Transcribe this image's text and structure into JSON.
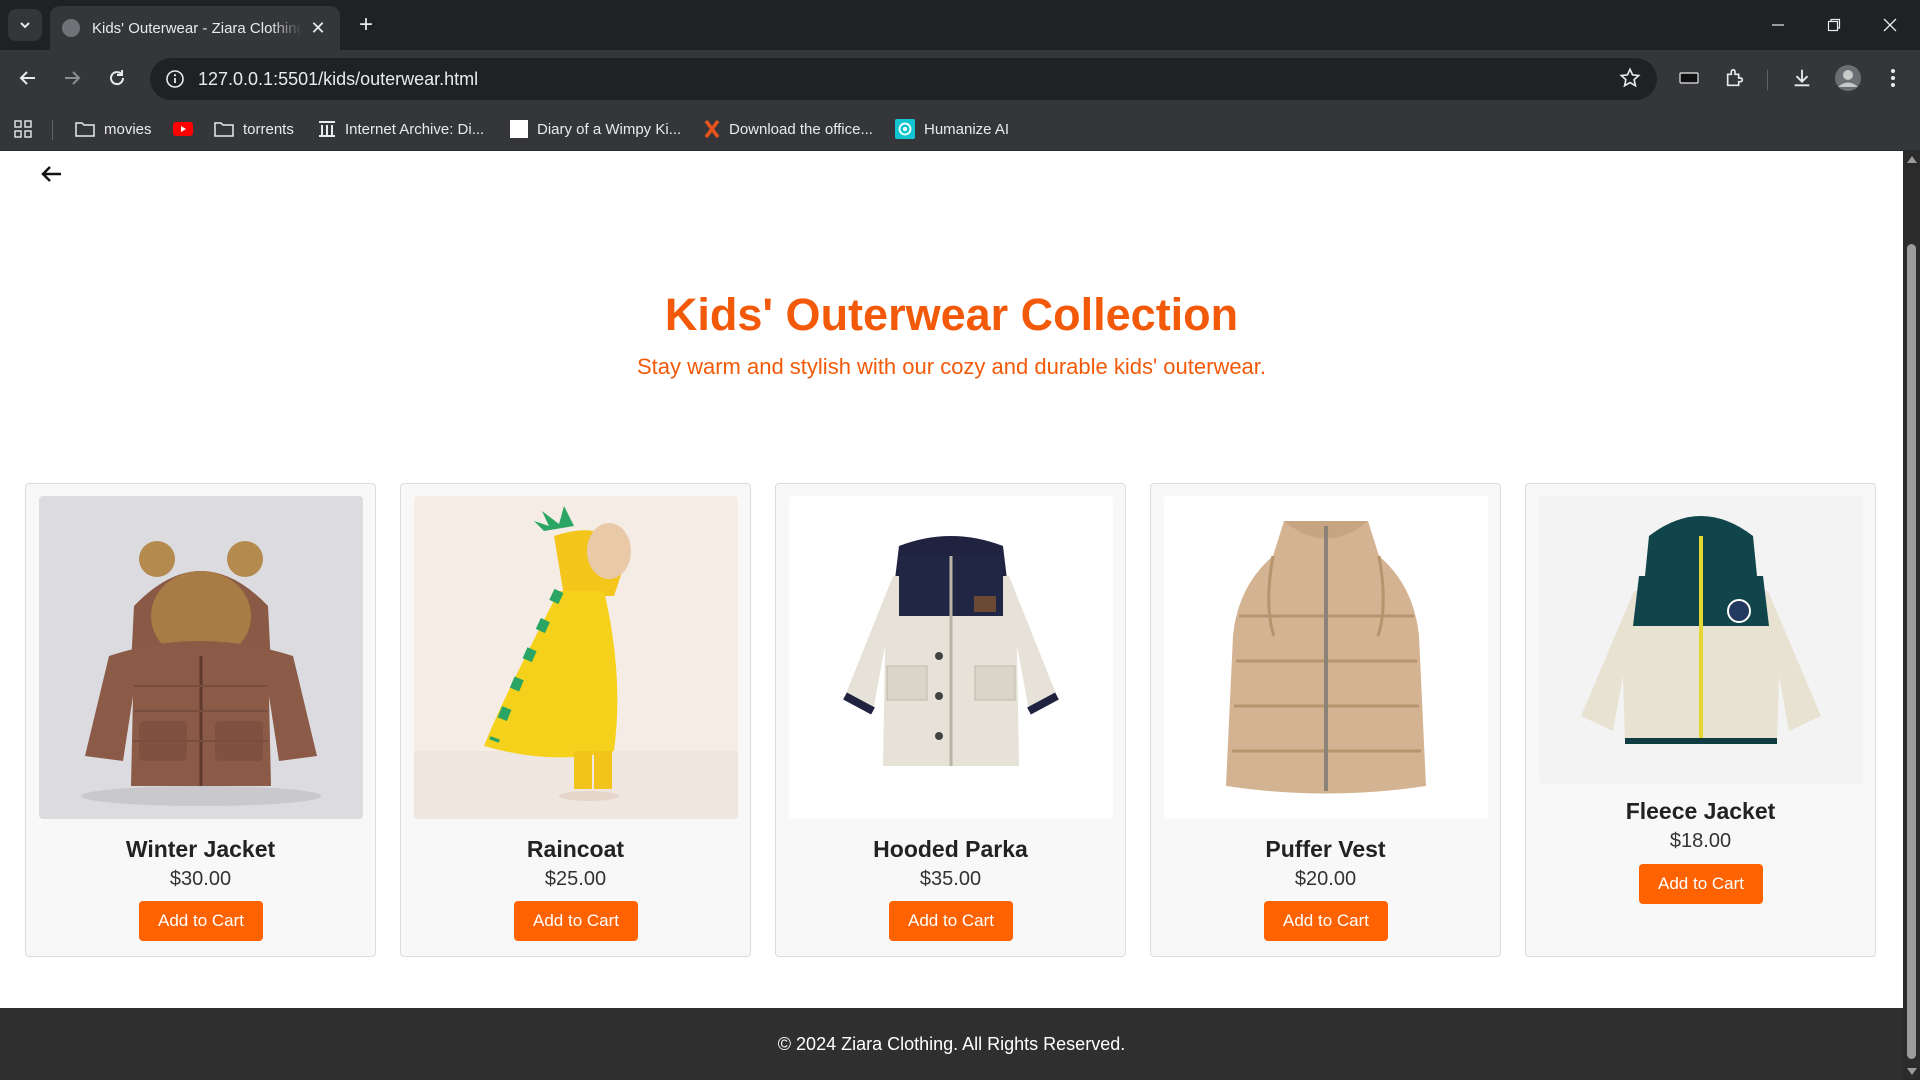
{
  "browser": {
    "tab_title": "Kids' Outerwear - Ziara Clothing",
    "url": "127.0.0.1:5501/kids/outerwear.html",
    "bookmarks": [
      {
        "label": "movies",
        "icon": "folder-icon"
      },
      {
        "label": "",
        "icon": "youtube-icon"
      },
      {
        "label": "torrents",
        "icon": "folder-icon"
      },
      {
        "label": "Internet Archive: Di...",
        "icon": "archive-icon"
      },
      {
        "label": "Diary of a Wimpy Ki...",
        "icon": "page-icon"
      },
      {
        "label": "Download the office...",
        "icon": "x-logo-icon"
      },
      {
        "label": "Humanize AI",
        "icon": "humanize-icon"
      }
    ]
  },
  "page": {
    "title": "Kids' Outerwear Collection",
    "subtitle": "Stay warm and stylish with our cozy and durable kids' outerwear.",
    "accent_color": "#f25a09",
    "button_color": "#ff6200",
    "products": [
      {
        "name": "Winter Jacket",
        "price": "$30.00",
        "button": "Add to Cart"
      },
      {
        "name": "Raincoat",
        "price": "$25.00",
        "button": "Add to Cart"
      },
      {
        "name": "Hooded Parka",
        "price": "$35.00",
        "button": "Add to Cart"
      },
      {
        "name": "Puffer Vest",
        "price": "$20.00",
        "button": "Add to Cart"
      },
      {
        "name": "Fleece Jacket",
        "price": "$18.00",
        "button": "Add to Cart"
      }
    ],
    "footer": "© 2024 Ziara Clothing. All Rights Reserved."
  }
}
